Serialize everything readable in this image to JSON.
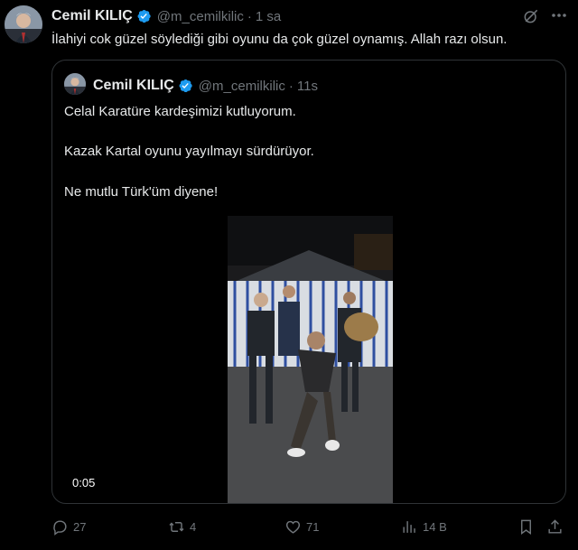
{
  "tweet": {
    "author": {
      "name": "Cemil KILIÇ",
      "handle": "@m_cemilkilic",
      "verified": true
    },
    "time": "1 sa",
    "text": "İlahiyi cok güzel söylediği gibi oyunu da çok güzel oynamış. Allah razı olsun.",
    "quoted": {
      "author": {
        "name": "Cemil KILIÇ",
        "handle": "@m_cemilkilic",
        "verified": true
      },
      "time": "11s",
      "paragraphs": [
        "Celal Karatüre kardeşimizi kutluyorum.",
        "Kazak Kartal oyunu yayılmayı sürdürüyor.",
        "Ne mutlu Türk'üm diyene!"
      ],
      "video": {
        "duration": "0:05"
      }
    },
    "actions": {
      "replies": "27",
      "reposts": "4",
      "likes": "71",
      "views": "14 B"
    }
  },
  "colors": {
    "background": "#000000",
    "text": "#e7e9ea",
    "secondary": "#71767b",
    "border": "#2f3336",
    "verified": "#1d9bf0"
  }
}
